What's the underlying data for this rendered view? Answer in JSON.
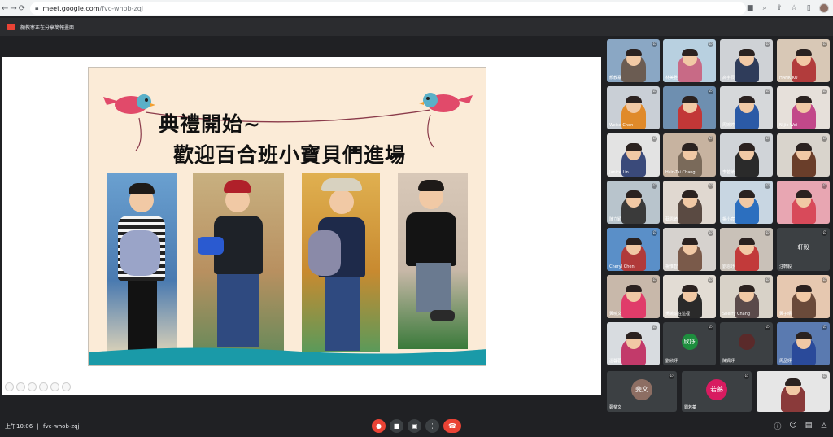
{
  "browser": {
    "url_host": "meet.google.com",
    "url_path": "/fvc-whob-zqj",
    "icons": [
      "back-icon",
      "forward-icon",
      "reload-icon",
      "lock-icon",
      "camera-icon",
      "zoom-icon",
      "share-icon",
      "star-icon",
      "sidebar-icon"
    ]
  },
  "banner": {
    "text": "顏教寨正在分享簡報畫面"
  },
  "slide": {
    "title_line1": "典禮開始~",
    "title_line2": "歡迎百合班小寶貝們進場"
  },
  "participants": [
    {
      "name": "顏教寨",
      "color": "#6b5c52",
      "bg": "#8aa7c4"
    },
    {
      "name": "林美雅",
      "color": "#c86a86",
      "bg": "#b8d0e0"
    },
    {
      "name": "高宇辰",
      "color": "#2f3c5a",
      "bg": "#cfd2d6"
    },
    {
      "name": "HANK KU",
      "color": "#b23c3c",
      "bg": "#d8c8b6"
    },
    {
      "name": "Weise Chen",
      "color": "#e08a2a",
      "bg": "#c9cfd6"
    },
    {
      "name": "",
      "color": "#c23737",
      "bg": "#6e8fb0"
    },
    {
      "name": "周婉婷",
      "color": "#2b5aa6",
      "bg": "#d6d8da"
    },
    {
      "name": "N-jie Wei",
      "color": "#c2488a",
      "bg": "#e6e0da"
    },
    {
      "name": "Janice Lin",
      "color": "#3a4a7a",
      "bg": "#e3e3e3"
    },
    {
      "name": "Hsin-Tai Chang",
      "color": "#7a6a5a",
      "bg": "#c7b3a0"
    },
    {
      "name": "李若綾",
      "color": "#2a2a2a",
      "bg": "#d0d4d8"
    },
    {
      "name": "",
      "color": "#6a3e2a",
      "bg": "#d9d4cc"
    },
    {
      "name": "陳立穎",
      "color": "#3a3a3a",
      "bg": "#b8c4cc"
    },
    {
      "name": "蔡恩綺",
      "color": "#5a4a42",
      "bg": "#e0d8d0"
    },
    {
      "name": "楊小宸",
      "color": "#2c6fbf",
      "bg": "#c8d6e2"
    },
    {
      "name": "",
      "color": "#d84a5a",
      "bg": "#e8a6b2"
    },
    {
      "name": "Cheryl Chen",
      "color": "#b03a3a",
      "bg": "#5a8fc8"
    },
    {
      "name": "楊惟智",
      "color": "#7a5a4a",
      "bg": "#d6d2ce"
    },
    {
      "name": "劉恩妤",
      "color": "#c23a3a",
      "bg": "#c9c1b8"
    },
    {
      "name": "汪軒毅",
      "avatar": "軒毅",
      "avatar_color": "#3c4043"
    },
    {
      "name": "黃曉文",
      "color": "#e03c6a",
      "bg": "#c8b8aa"
    },
    {
      "name": "吳婉瑜在這裡",
      "color": "#2a2a2a",
      "bg": "#e2dcd4"
    },
    {
      "name": "Sherry Chang",
      "color": "#5a4a4a",
      "bg": "#d8d2c8"
    },
    {
      "name": "黃子晴",
      "color": "#6a4a3a",
      "bg": "#e6c8b0"
    },
    {
      "name": "溫馨蓉",
      "color": "#c23a6a",
      "bg": "#d8dce0"
    },
    {
      "name": "劉欣妤",
      "avatar": "欣妤",
      "avatar_color": "#1e8e3e"
    },
    {
      "name": "陳姵妤",
      "avatar": "",
      "avatar_color": "#5a2a2a"
    },
    {
      "name": "周品妤",
      "color": "#2a4a9a",
      "bg": "#5a7ab0"
    },
    {
      "name": "鄭斐文",
      "avatar": "斐文",
      "avatar_color": "#8d6e63"
    },
    {
      "name": "劉若蓁",
      "avatar": "若蓁",
      "avatar_color": "#d81b60"
    },
    {
      "name": "",
      "color": "#8a3a3a",
      "bg": "#e6e6e6"
    }
  ],
  "bottom": {
    "time": "上午10:06",
    "separator": "|",
    "meeting_code": "fvc-whob-zqj"
  }
}
